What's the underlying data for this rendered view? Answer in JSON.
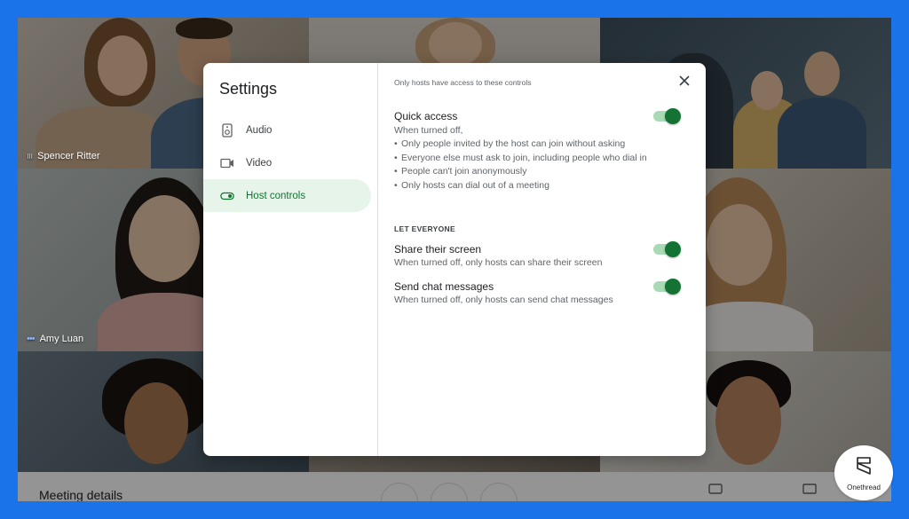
{
  "participants": [
    {
      "name": "Spencer Ritter",
      "indicator": "ııı"
    },
    {
      "name": "Amy Luan",
      "indicator": "•••"
    }
  ],
  "bottom_bar": {
    "meeting_details": "Meeting details"
  },
  "settings": {
    "title": "Settings",
    "nav": [
      {
        "label": "Audio",
        "icon": "speaker-icon"
      },
      {
        "label": "Video",
        "icon": "video-camera-icon"
      },
      {
        "label": "Host controls",
        "icon": "toggle-icon",
        "active": true
      }
    ],
    "note": "Only hosts have access to these controls",
    "quick_access": {
      "title": "Quick access",
      "desc": "When turned off,",
      "bullets": [
        "Only people invited by the host can join without asking",
        "Everyone else must ask to join, including people who dial in",
        "People can't join anonymously",
        "Only hosts can dial out of a meeting"
      ],
      "enabled": true
    },
    "section_label": "LET EVERYONE",
    "share_screen": {
      "title": "Share their screen",
      "desc": "When turned off, only hosts can share their screen",
      "enabled": true
    },
    "chat": {
      "title": "Send chat messages",
      "desc": "When turned off, only hosts can send chat messages",
      "enabled": true
    }
  },
  "badge": {
    "label": "Onethread"
  },
  "colors": {
    "accent": "#137333",
    "toggle_track": "#a8dab5",
    "frame": "#1a73e8"
  }
}
